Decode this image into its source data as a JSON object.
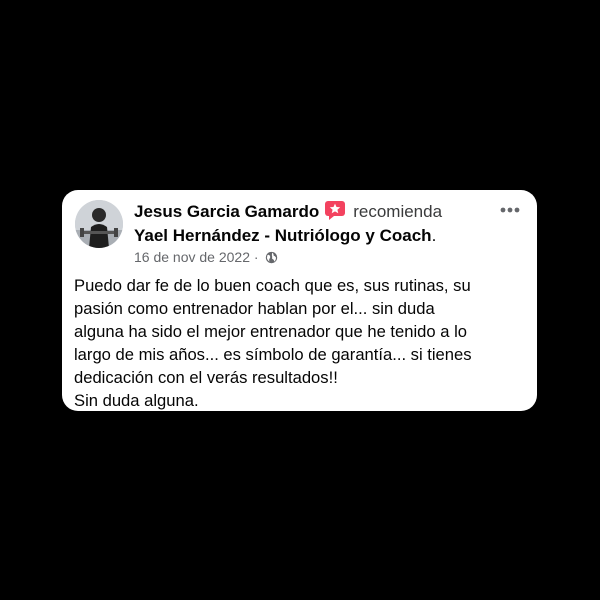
{
  "post": {
    "author": "Jesus Garcia Gamardo",
    "action": "recomienda",
    "subject": "Yael Hernández - Nutriólogo y Coach",
    "subject_suffix": ".",
    "date": "16 de nov de 2022",
    "separator": "·",
    "privacy_icon": "globe-icon",
    "recommend_icon": "recommend-badge-icon",
    "menu_icon": "more-icon",
    "body": "Puedo dar fe de lo buen coach que es, sus rutinas, su\npasión como entrenador hablan por el... sin duda\nalguna ha sido el mejor entrenador que he tenido a lo\nlargo de mis años... es símbolo de garantía... si tienes\ndedicación con el verás resultados!!\nSin duda alguna."
  },
  "colors": {
    "background": "#000000",
    "card": "#ffffff",
    "text": "#050505",
    "secondary_text": "#65676b",
    "recommend_badge": "#f3425f"
  }
}
